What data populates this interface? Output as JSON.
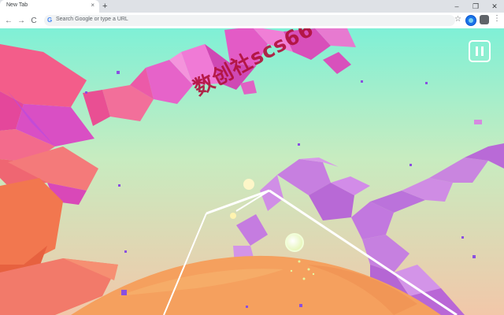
{
  "browser": {
    "tab_title": "New Tab",
    "tab_close_glyph": "×",
    "new_tab_glyph": "+",
    "back_glyph": "←",
    "forward_glyph": "→",
    "reload_glyph": "C",
    "omnibox_icon": "G",
    "omnibox_placeholder": "Search Google or type a URL",
    "star_glyph": "☆",
    "menu_glyph": "⋮",
    "window_buttons": [
      "–",
      "❐",
      "✕"
    ]
  },
  "game": {
    "watermark": "数创社scs66",
    "pause_icon": "pause-icon",
    "colors": {
      "sky_top": "#7ff0d6",
      "sky_bottom": "#f2c7a9",
      "crystal_pink": "#e453c9",
      "crystal_coral": "#f46a6a",
      "crystal_violet": "#c77fe0",
      "planet": "#f5a05e"
    }
  }
}
